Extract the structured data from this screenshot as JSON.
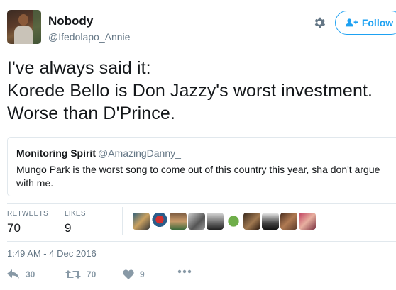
{
  "user": {
    "name": "Nobody",
    "handle": "@Ifedolapo_Annie"
  },
  "follow_button": {
    "label": "Follow",
    "icon": "add-user-icon",
    "color": "#1da1f2"
  },
  "tweet": {
    "lines": [
      "I've always said it:",
      "Korede Bello is Don Jazzy's worst investment.",
      "Worse than D'Prince."
    ]
  },
  "quoted_tweet": {
    "name": "Monitoring Spirit",
    "handle": "@AmazingDanny_",
    "text": "Mungo Park is the worst song to come out of this country this year, sha don't argue with me."
  },
  "stats": {
    "retweets_label": "RETWEETS",
    "retweets_value": "70",
    "likes_label": "LIKES",
    "likes_value": "9"
  },
  "likers_count": 10,
  "timestamp": "1:49 AM - 4 Dec 2016",
  "actions": {
    "reply_count": "30",
    "retweet_count": "70",
    "like_count": "9"
  }
}
